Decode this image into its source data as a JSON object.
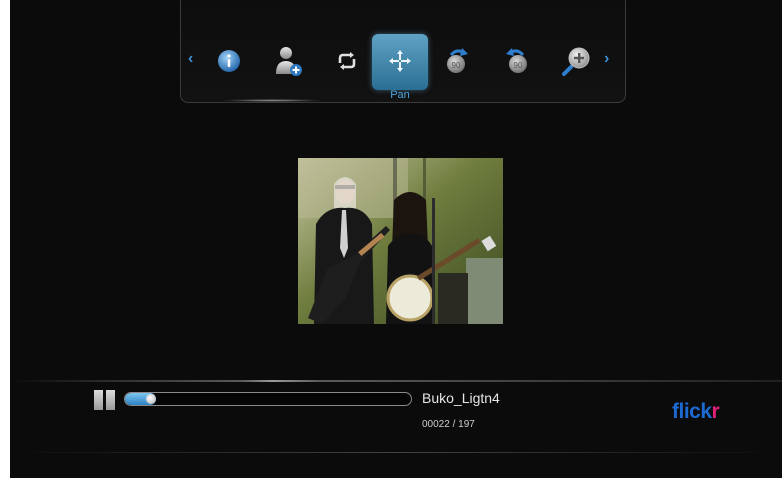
{
  "toolbar": {
    "items": [
      {
        "icon": "info-icon"
      },
      {
        "icon": "user-add-icon"
      },
      {
        "icon": "repeat-icon"
      },
      {
        "icon": "pan-icon",
        "selected": true,
        "label": "Pan"
      },
      {
        "icon": "rotate-right-icon"
      },
      {
        "icon": "rotate-left-icon"
      },
      {
        "icon": "zoom-in-icon"
      }
    ],
    "prev_glyph": "‹",
    "next_glyph": "›",
    "selected_label": "Pan"
  },
  "player": {
    "title": "Buko_Ligtn4",
    "counter": "00022 / 197",
    "progress_fraction": 0.11
  },
  "brand": {
    "part1": "flick",
    "part2": "r"
  },
  "colors": {
    "accent": "#3d8fd8",
    "selection": "#3f8ab3",
    "brand_blue": "#1c6ad1",
    "brand_pink": "#e0207a"
  }
}
